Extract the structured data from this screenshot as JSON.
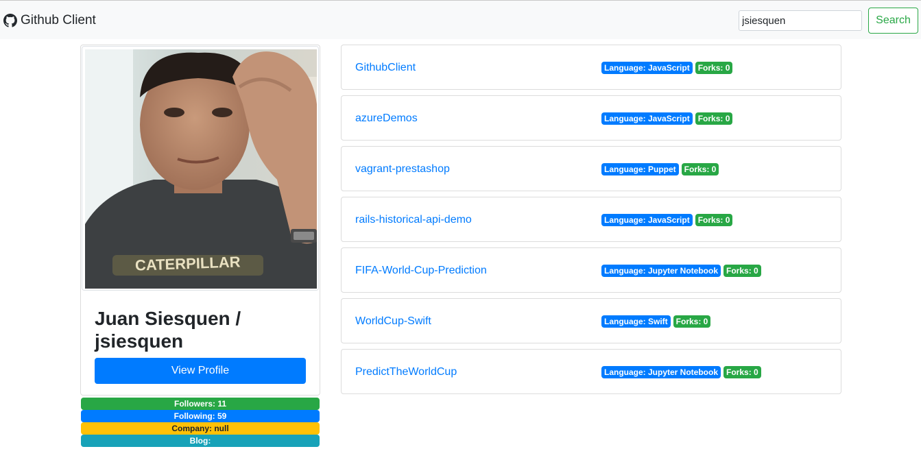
{
  "navbar": {
    "brand": "Github Client",
    "brand_icon": "github-icon",
    "search_value": "jsiesquen",
    "search_button": "Search"
  },
  "profile": {
    "image": "user-avatar-photo",
    "name": "Juan Siesquen / jsiesquen",
    "view_button": "View Profile",
    "followers": "Followers: 11",
    "following": "Following: 59",
    "company": "Company: null",
    "blog": "Blog:"
  },
  "repos": [
    {
      "name": "GithubClient",
      "language": "Language: JavaScript",
      "forks": "Forks: 0"
    },
    {
      "name": "azureDemos",
      "language": "Language: JavaScript",
      "forks": "Forks: 0"
    },
    {
      "name": "vagrant-prestashop",
      "language": "Language: Puppet",
      "forks": "Forks: 0"
    },
    {
      "name": "rails-historical-api-demo",
      "language": "Language: JavaScript",
      "forks": "Forks: 0"
    },
    {
      "name": "FIFA-World-Cup-Prediction",
      "language": "Language: Jupyter Notebook",
      "forks": "Forks: 0"
    },
    {
      "name": "WorldCup-Swift",
      "language": "Language: Swift",
      "forks": "Forks: 0"
    },
    {
      "name": "PredictTheWorldCup",
      "language": "Language: Jupyter Notebook",
      "forks": "Forks: 0"
    }
  ],
  "colors": {
    "primary": "#007bff",
    "success": "#28a745",
    "warning": "#ffc107",
    "info": "#17a2b8",
    "navbar_bg": "#f8f9fa"
  }
}
